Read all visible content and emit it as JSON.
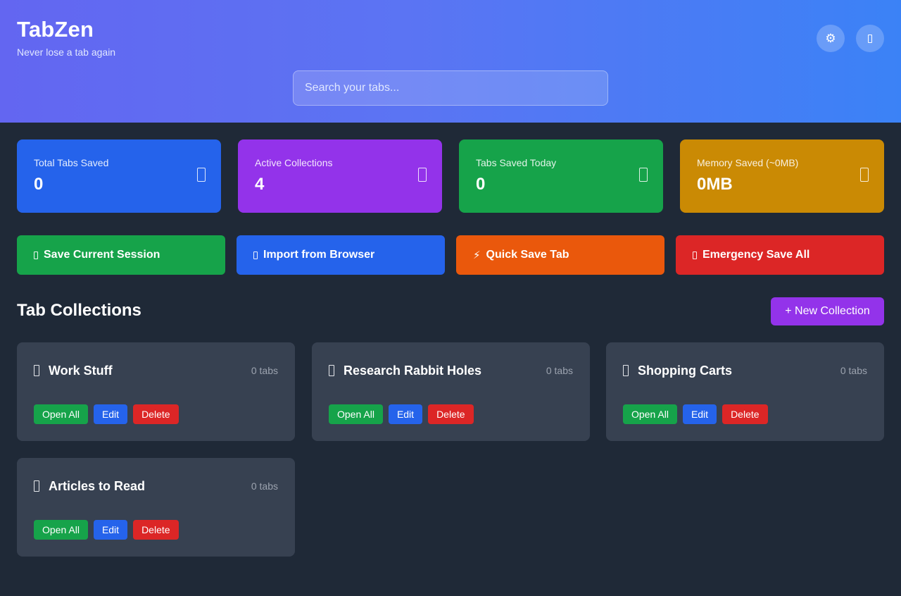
{
  "app": {
    "title": "TabZen",
    "subtitle": "Never lose a tab again"
  },
  "header": {
    "settings_icon": "⚙",
    "settings_icon_name": "gear-icon",
    "profile_icon": "",
    "profile_icon_name": "user-icon"
  },
  "search": {
    "placeholder": "Search your tabs...",
    "value": ""
  },
  "stats": [
    {
      "label": "Total Tabs Saved",
      "value": "0",
      "color": "#2563eb",
      "icon": "tab-icon"
    },
    {
      "label": "Active Collections",
      "value": "4",
      "color": "#9333ea",
      "icon": "folder-icon"
    },
    {
      "label": "Tabs Saved Today",
      "value": "0",
      "color": "#16a34a",
      "icon": "calendar-icon"
    },
    {
      "label": "Memory Saved (~0MB)",
      "value": "0MB",
      "color": "#ca8a04",
      "icon": "memory-icon"
    }
  ],
  "actions": [
    {
      "label": "Save Current Session",
      "color": "#16a34a",
      "icon": "save-icon"
    },
    {
      "label": "Import from Browser",
      "color": "#2563eb",
      "icon": "import-icon"
    },
    {
      "label": "Quick Save Tab",
      "color": "#ea580c",
      "icon": "lightning-icon",
      "glyph": "⚡"
    },
    {
      "label": "Emergency Save All",
      "color": "#dc2626",
      "icon": "alert-icon"
    }
  ],
  "collections_section": {
    "title": "Tab Collections",
    "new_button": "+ New Collection"
  },
  "collections": [
    {
      "name": "Work Stuff",
      "count": "0 tabs"
    },
    {
      "name": "Research Rabbit Holes",
      "count": "0 tabs"
    },
    {
      "name": "Shopping Carts",
      "count": "0 tabs"
    },
    {
      "name": "Articles to Read",
      "count": "0 tabs"
    }
  ],
  "collection_buttons": {
    "open": "Open All",
    "edit": "Edit",
    "delete": "Delete",
    "open_color": "#16a34a",
    "edit_color": "#2563eb",
    "delete_color": "#dc2626"
  }
}
